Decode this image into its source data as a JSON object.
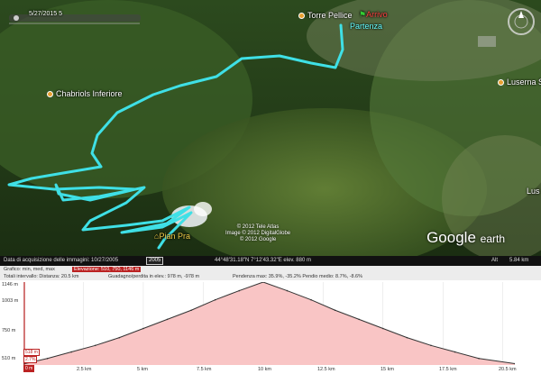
{
  "map": {
    "places": {
      "chabriols": "Chabriols Inferiore",
      "torre": "Torre Pellice",
      "arrivo": "Arrivo",
      "partenza": "Partenza",
      "luserna": "Luserna S",
      "lus": "Lus",
      "pian_pra": "Pian Pra"
    },
    "timeslider_label": "5/27/2015 5",
    "attribution": [
      "© 2012 Tele Atlas",
      "Image © 2012 DigitalGlobe",
      "© 2012 Google"
    ],
    "brand": "Google",
    "brand_suffix": "earth",
    "route_color": "#3fe0e6"
  },
  "status_bar": {
    "acquisition": "Data di acquisizione delle immagini: 10/27/2005",
    "year": "2005",
    "coords": "44°48'31.18\"N   7°12'43.32\"E  elev.  880 m",
    "alt_label": "Alt",
    "alt_value": "5.84 km"
  },
  "profile": {
    "graph_label": "Grafico:  min, med, max",
    "graph_highlight": "Elevazione: 510, 750, 1146 m",
    "interval": "Totali intervallo:  Distanza: 20.5 km",
    "gain": "Guadagno/perdita in elev.: 978 m, -978 m",
    "slope": "Pendenza max: 35.9%, -35.2%  Pendio medio: 8.7%, -8.6%",
    "fill_color": "#f9c5c5",
    "line_color": "#333333",
    "y_ticks": [
      "1146 m",
      "1003 m",
      "750 m",
      "510 m"
    ],
    "x_ticks": [
      "2.5 km",
      "5 km",
      "7.5 km",
      "10 km",
      "12.5 km",
      "15 km",
      "17.5 km",
      "20.5 km"
    ],
    "start_box_top": "518 m",
    "start_box_pct": "2.7%",
    "start_box_km": "0 m"
  },
  "chart_data": {
    "type": "area",
    "x": [
      0,
      1,
      2,
      3,
      4,
      5,
      6,
      7,
      8,
      9,
      10,
      11,
      12,
      13,
      14,
      15,
      16,
      17,
      18,
      19,
      20.5
    ],
    "y": [
      518,
      560,
      610,
      660,
      720,
      790,
      860,
      930,
      1010,
      1080,
      1146,
      1080,
      1010,
      930,
      860,
      790,
      720,
      660,
      610,
      560,
      520
    ],
    "ylim": [
      510,
      1146
    ],
    "xlim": [
      0,
      20.5
    ]
  }
}
